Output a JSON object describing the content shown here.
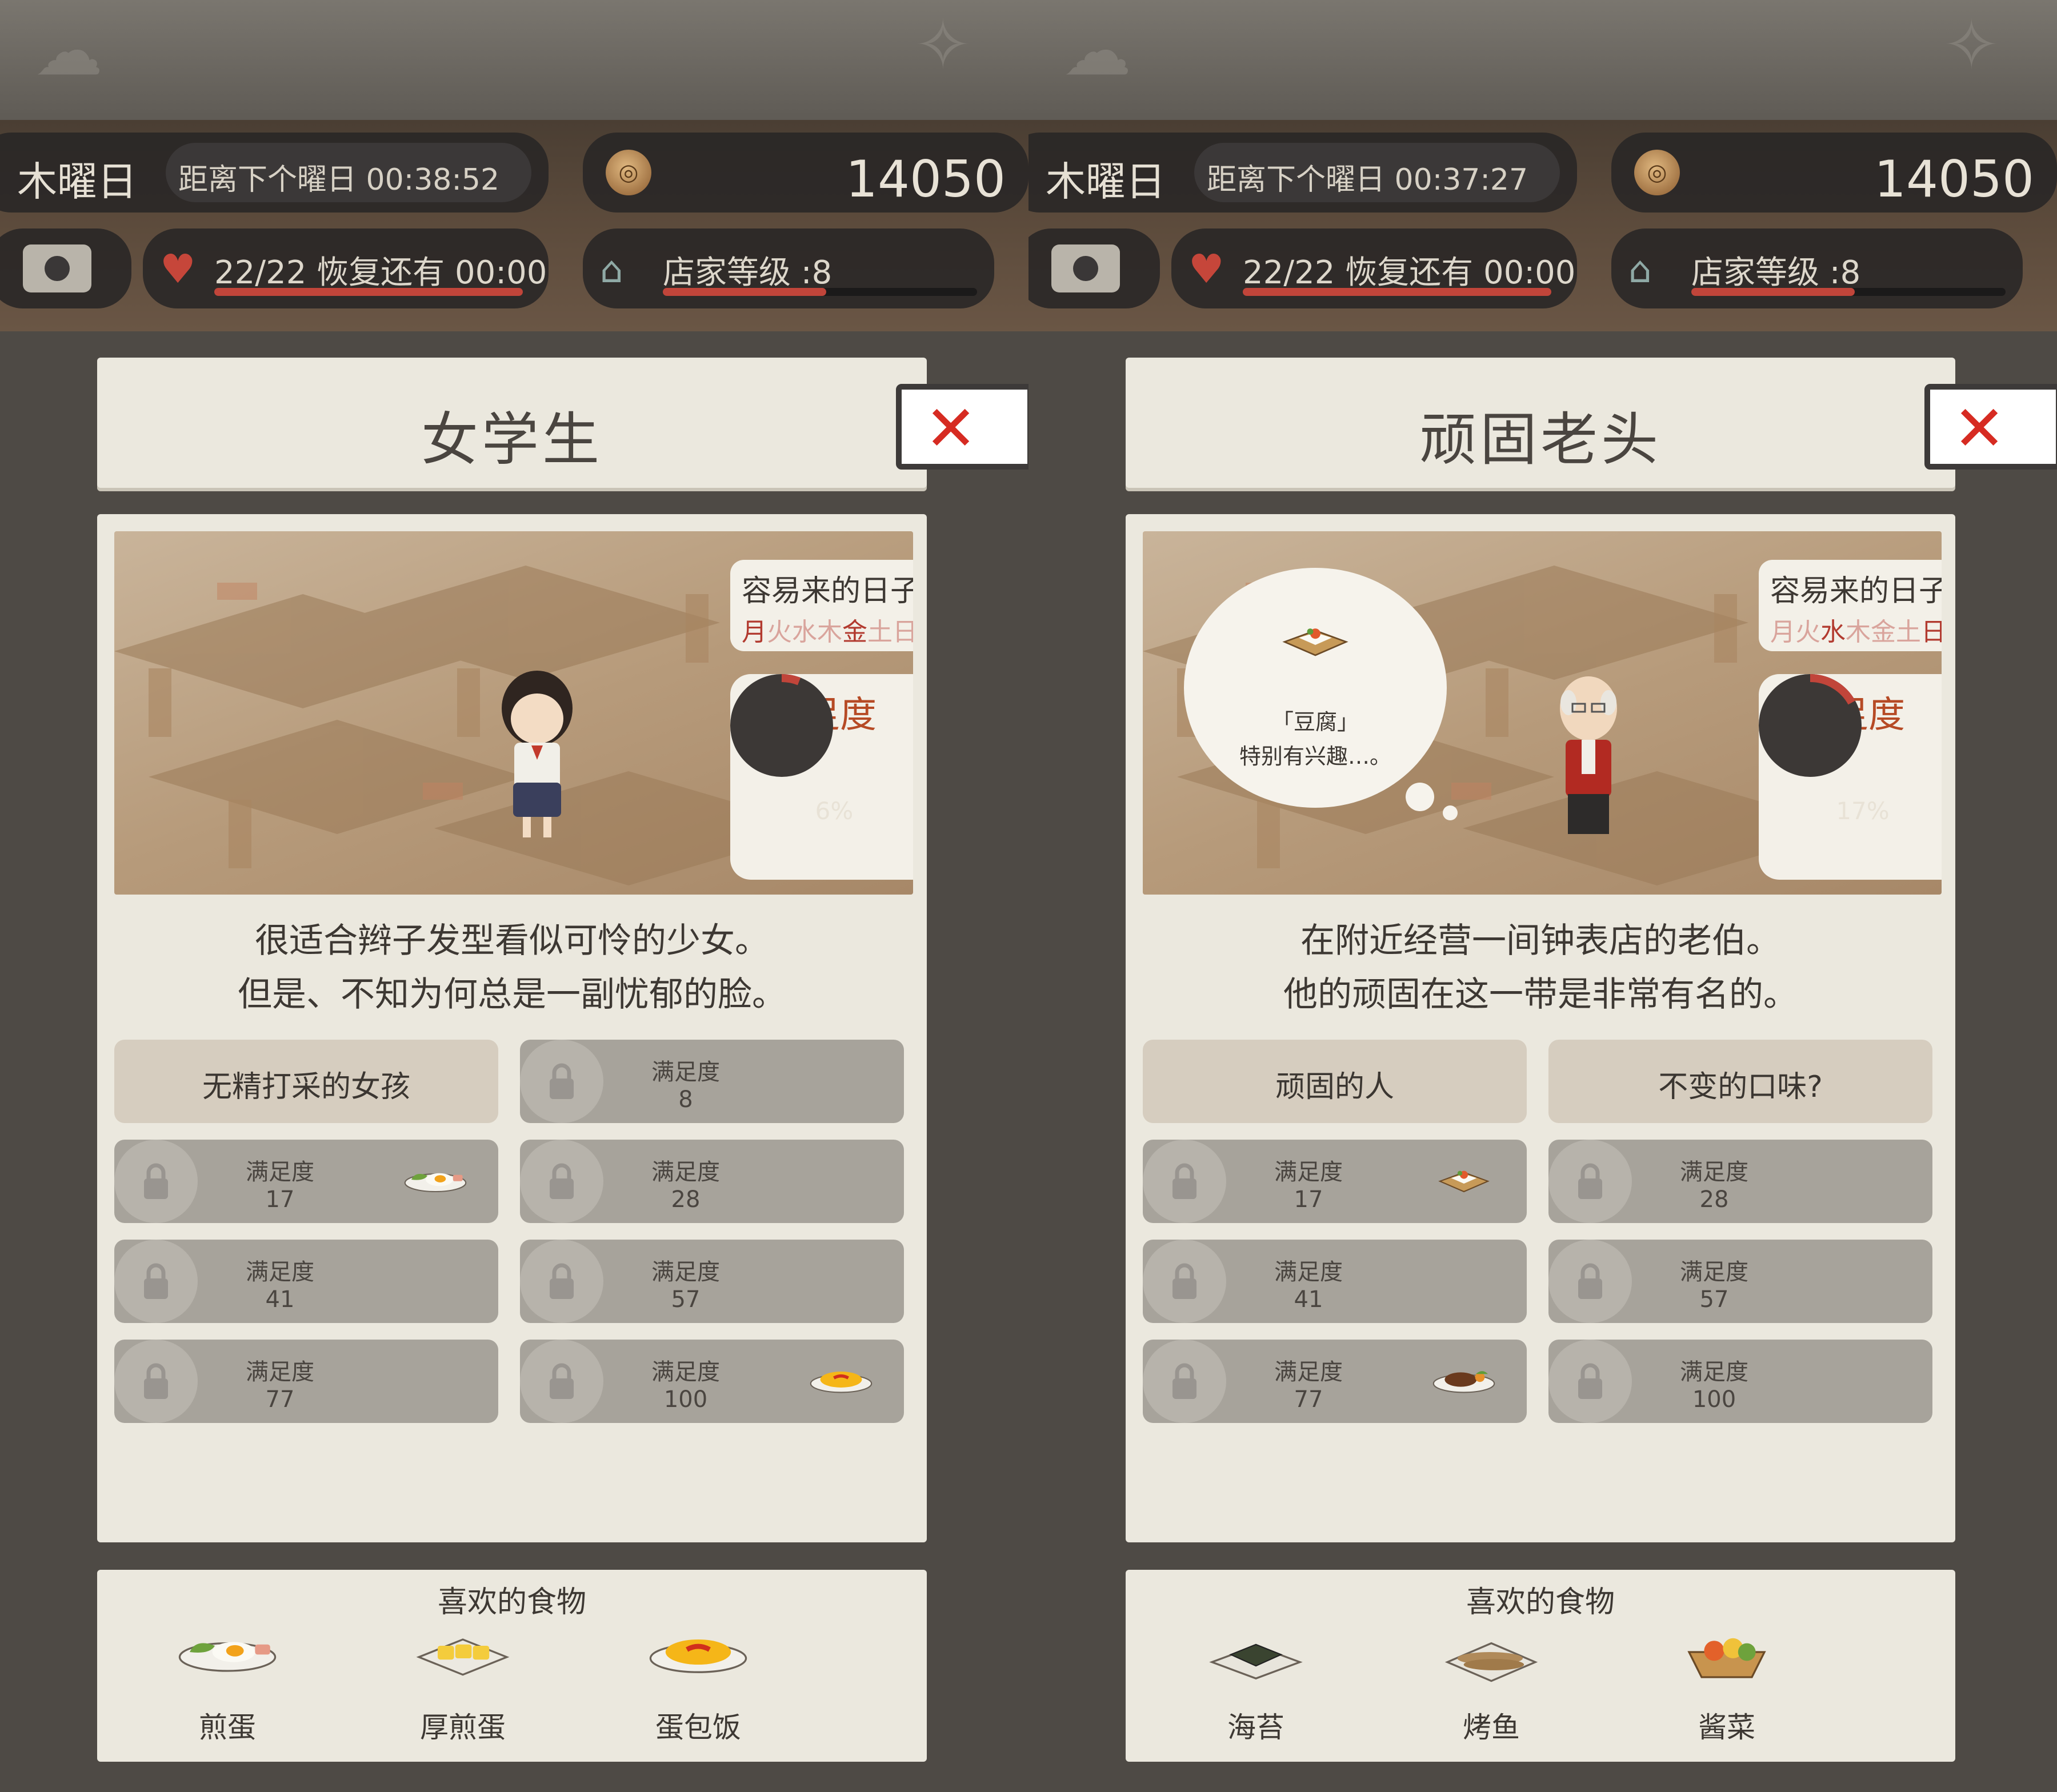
{
  "panels": [
    {
      "day_name": "木曜日",
      "timer": "距离下个曜日 00:38:52",
      "coins": "14050",
      "energy": "22/22  恢复还有  00:00",
      "shop_level": "店家等级 :8",
      "shop_level_progress": 0.52,
      "title": "女学生",
      "close": "✕",
      "days_label": "容易来的日子",
      "days": [
        {
          "d": "月",
          "on": true
        },
        {
          "d": "火",
          "on": false
        },
        {
          "d": "水",
          "on": false
        },
        {
          "d": "木",
          "on": false
        },
        {
          "d": "金",
          "on": true
        },
        {
          "d": "土",
          "on": false
        },
        {
          "d": "日",
          "on": false
        }
      ],
      "satisfaction_label": "满足度",
      "satisfaction_value": "6%",
      "satisfaction_fraction": 0.06,
      "description_line1": "很适合辫子发型看似可怜的少女。",
      "description_line2": "但是、不知为何总是一副忧郁的脸。",
      "traits": [
        {
          "type": "unlocked",
          "label": "无精打采的女孩"
        },
        {
          "type": "locked",
          "req_label": "满足度",
          "req_value": "8",
          "reward": "none"
        },
        {
          "type": "locked",
          "req_label": "满足度",
          "req_value": "17",
          "reward": "fried-egg"
        },
        {
          "type": "locked",
          "req_label": "满足度",
          "req_value": "28",
          "reward": "none"
        },
        {
          "type": "locked",
          "req_label": "满足度",
          "req_value": "41",
          "reward": "none"
        },
        {
          "type": "locked",
          "req_label": "满足度",
          "req_value": "57",
          "reward": "none"
        },
        {
          "type": "locked",
          "req_label": "满足度",
          "req_value": "77",
          "reward": "none"
        },
        {
          "type": "locked",
          "req_label": "满足度",
          "req_value": "100",
          "reward": "omurice"
        }
      ],
      "fav_title": "喜欢的食物",
      "favorites": [
        {
          "name": "煎蛋",
          "icon": "fried-egg"
        },
        {
          "name": "厚煎蛋",
          "icon": "tamagoyaki"
        },
        {
          "name": "蛋包饭",
          "icon": "omurice"
        }
      ]
    },
    {
      "day_name": "木曜日",
      "timer": "距离下个曜日 00:37:27",
      "coins": "14050",
      "energy": "22/22  恢复还有  00:00",
      "shop_level": "店家等级 :8",
      "shop_level_progress": 0.52,
      "title": "顽固老头",
      "close": "✕",
      "days_label": "容易来的日子",
      "days": [
        {
          "d": "月",
          "on": false
        },
        {
          "d": "火",
          "on": false
        },
        {
          "d": "水",
          "on": true
        },
        {
          "d": "木",
          "on": false
        },
        {
          "d": "金",
          "on": false
        },
        {
          "d": "土",
          "on": false
        },
        {
          "d": "日",
          "on": true
        }
      ],
      "satisfaction_label": "满足度",
      "satisfaction_value": "17%",
      "satisfaction_fraction": 0.17,
      "bubble_line1": "「豆腐」",
      "bubble_line2": "特别有兴趣…。",
      "description_line1": "在附近经营一间钟表店的老伯。",
      "description_line2": "他的顽固在这一带是非常有名的。",
      "traits": [
        {
          "type": "unlocked",
          "label": "顽固的人"
        },
        {
          "type": "unlocked",
          "label": "不变的口味?"
        },
        {
          "type": "locked",
          "req_label": "满足度",
          "req_value": "17",
          "reward": "tofu"
        },
        {
          "type": "locked",
          "req_label": "满足度",
          "req_value": "28",
          "reward": "none"
        },
        {
          "type": "locked",
          "req_label": "满足度",
          "req_value": "41",
          "reward": "none"
        },
        {
          "type": "locked",
          "req_label": "满足度",
          "req_value": "57",
          "reward": "none"
        },
        {
          "type": "locked",
          "req_label": "满足度",
          "req_value": "77",
          "reward": "hamburg-steak"
        },
        {
          "type": "locked",
          "req_label": "满足度",
          "req_value": "100",
          "reward": "none"
        }
      ],
      "fav_title": "喜欢的食物",
      "favorites": [
        {
          "name": "海苔",
          "icon": "nori"
        },
        {
          "name": "烤鱼",
          "icon": "grilled-fish"
        },
        {
          "name": "酱菜",
          "icon": "pickles"
        }
      ]
    }
  ],
  "colors": {
    "accent_red": "#c1453a",
    "close_red": "#d62b22",
    "satisfaction_orange": "#b64a25",
    "card_bg": "#ebe8de"
  }
}
